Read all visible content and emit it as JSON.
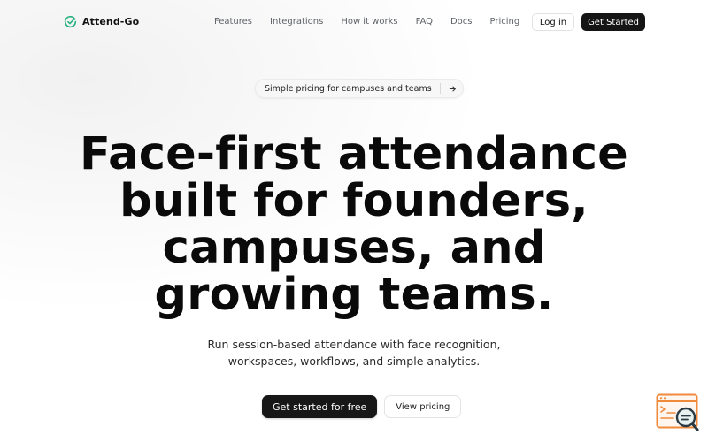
{
  "brand": {
    "name": "Attend-Go",
    "logo_icon": "circle-check-icon",
    "accent_color": "#22b07d"
  },
  "nav": {
    "items": [
      "Features",
      "Integrations",
      "How it works",
      "FAQ",
      "Docs",
      "Pricing"
    ]
  },
  "header": {
    "login_label": "Log in",
    "get_started_label": "Get Started"
  },
  "announcement": {
    "text": "Simple pricing for campuses and teams",
    "arrow_icon": "arrow-right-icon"
  },
  "hero": {
    "title_lines": [
      "Face-first attendance",
      "built for founders,",
      "campuses, and",
      "growing teams."
    ],
    "subtitle_lines": [
      "Run session-based attendance with face recognition,",
      "workspaces, workflows, and simple analytics."
    ],
    "primary_cta": "Get started for free",
    "secondary_cta": "View pricing"
  },
  "widget": {
    "icon": "chat-search-icon",
    "color": "#f08a3c"
  }
}
